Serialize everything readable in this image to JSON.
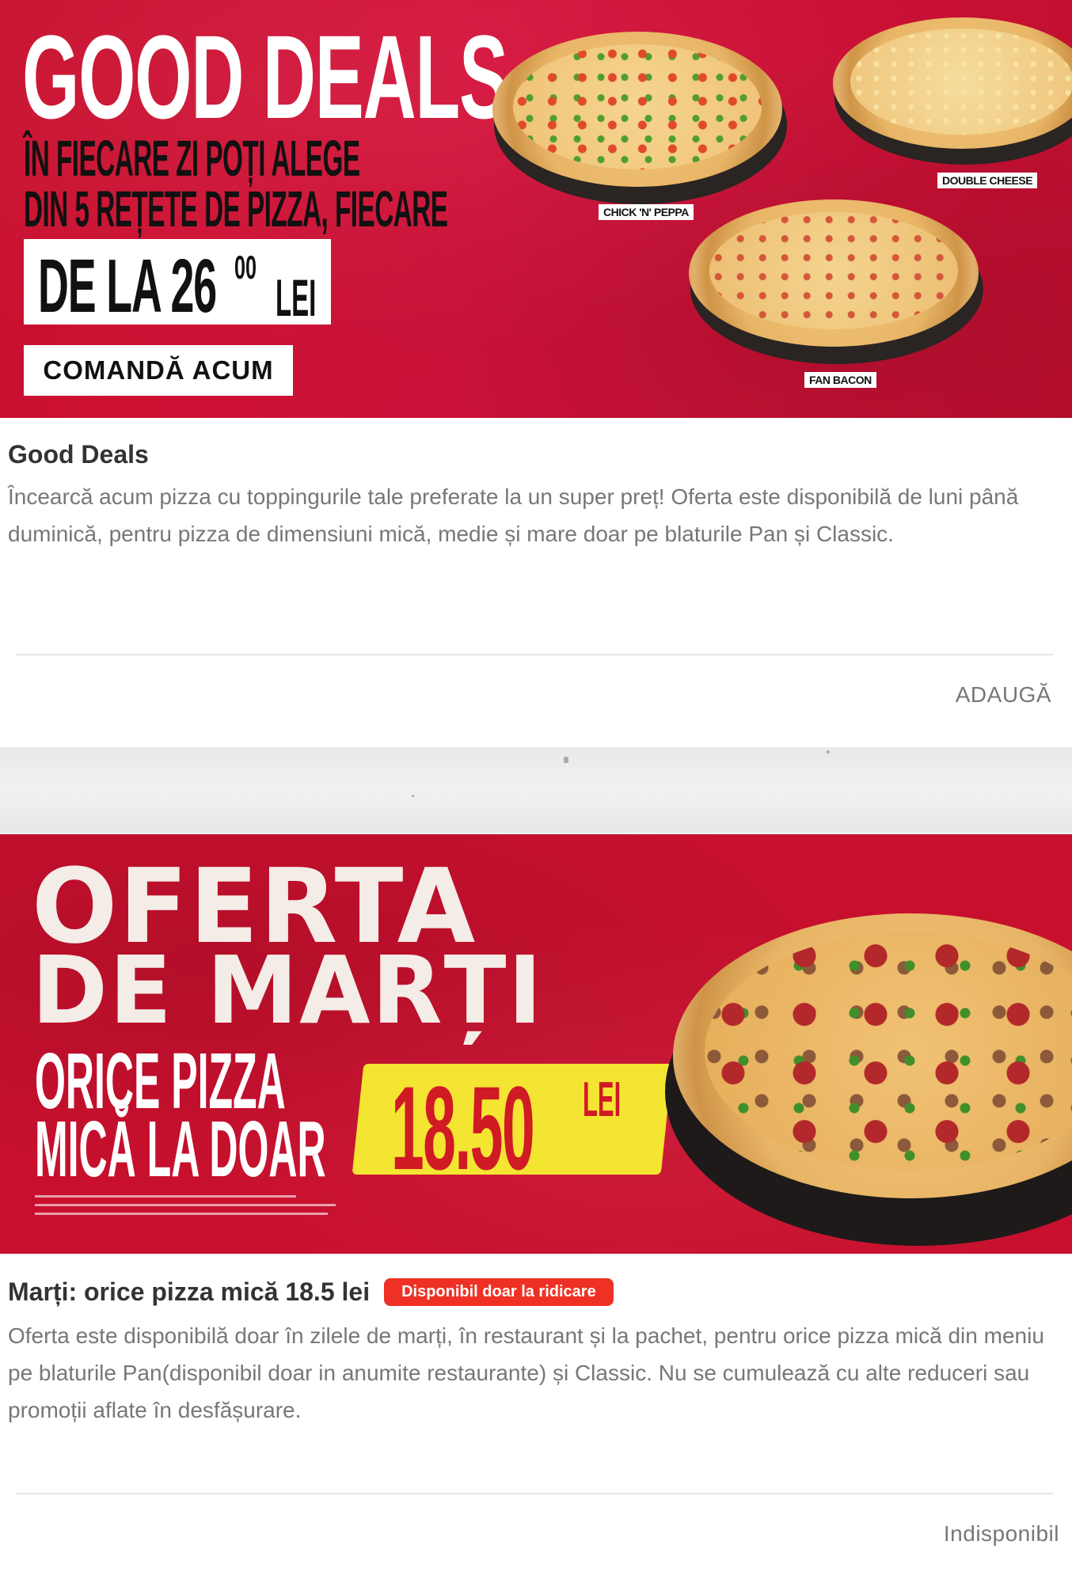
{
  "deal1": {
    "banner": {
      "title": "GOOD DEALS",
      "line1": "ÎN FIECARE ZI POȚI ALEGE",
      "line2": "DIN 5 REȚETE DE PIZZA, FIECARE",
      "price_prefix": "DE LA 26",
      "price_cents": "00",
      "price_unit": "LEI",
      "cta": "COMANDĂ ACUM",
      "pizza_labels": [
        "CHICK 'N' PEPPA",
        "DOUBLE CHEESE",
        "FAN BACON"
      ]
    },
    "title": "Good Deals",
    "description": "Încearcă acum pizza cu toppingurile tale preferate la un super preț! Oferta este disponibilă de luni până duminică, pentru pizza de dimensiuni mică, medie și mare doar pe blaturile Pan și Classic.",
    "action": "ADAUGĂ"
  },
  "deal2": {
    "banner": {
      "title_line1": "OFERTA",
      "title_line2": "DE MARȚI",
      "line1": "ORICE PIZZA",
      "line2": "MICĂ LA DOAR",
      "price": "18.50",
      "price_unit": "LEI"
    },
    "title": "Marți: orice pizza mică 18.5 lei",
    "badge": "Disponibil doar la ridicare",
    "description": "Oferta este disponibilă doar în zilele de marți, în restaurant și la pachet, pentru orice pizza mică din meniu pe blaturile Pan(disponibil doar in anumite restaurante) și Classic. Nu se cumulează cu alte reduceri sau promoții aflate în desfășurare.",
    "action": "Indisponibil"
  },
  "colors": {
    "brand_red": "#c8102e",
    "badge_red": "#ee3124",
    "price_yellow": "#f3e532",
    "text_gray": "#777777"
  }
}
